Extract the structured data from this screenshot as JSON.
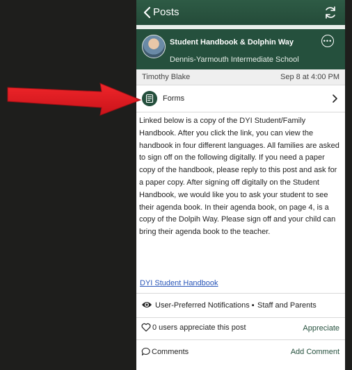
{
  "nav": {
    "back_label": "Posts"
  },
  "post": {
    "title": "Student Handbook & Dolphin Way",
    "school": "Dennis-Yarmouth Intermediate School",
    "author": "Timothy Blake",
    "date": "Sep 8 at 4:00 PM",
    "forms_label": "Forms",
    "body": "Linked below is a copy of the DYI Student/Family Handbook.  After you click the link, you can view the handbook in four different languages. All families are asked to sign off on the following digitally.  If you need a paper copy of the handbook, please reply to this post and ask for a paper copy.  After signing off digitally on the Student Handbook, we would like you to ask your student to see their agenda book.  In their agenda book, on page 4, is a copy of the Dolpih Way.  Please sign off and your child can bring their agenda book to the teacher.",
    "link_text": "DYI Student Handbook"
  },
  "notifications": {
    "label": "User-Preferred Notifications",
    "separator": "▪",
    "audience": "Staff and Parents"
  },
  "appreciation": {
    "count_text": "0 users appreciate this post",
    "button": "Appreciate"
  },
  "comments": {
    "label": "Comments",
    "add_button": "Add Comment"
  },
  "colors": {
    "brand_green": "#25503d",
    "link_blue": "#2855b8",
    "annotation_red": "#e3191b"
  },
  "icons": [
    "chevron-left-icon",
    "refresh-icon",
    "more-icon",
    "forms-icon",
    "chevron-right-icon",
    "eye-icon",
    "heart-icon",
    "comment-icon"
  ]
}
